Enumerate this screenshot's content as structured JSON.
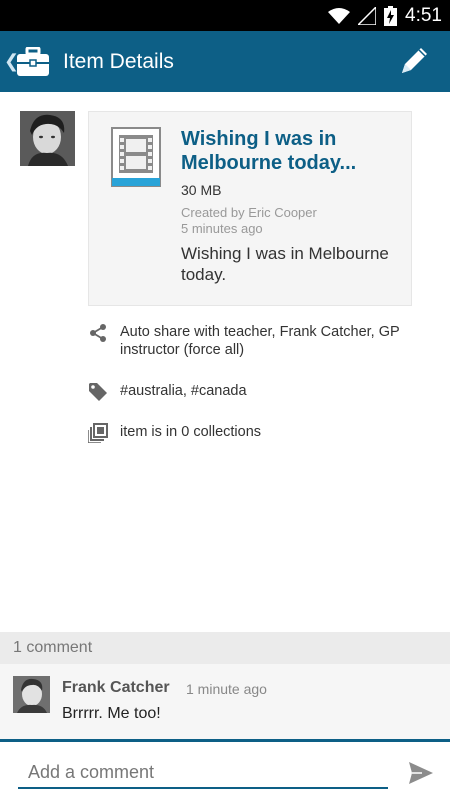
{
  "status_bar": {
    "time": "4:51"
  },
  "app_bar": {
    "title": "Item Details"
  },
  "item": {
    "title": "Wishing I was in Melbourne today...",
    "size": "30 MB",
    "created_by": "Created by Eric Cooper",
    "created_ago": "5 minutes ago",
    "description": "Wishing I was in Melbourne today."
  },
  "info": {
    "share": "Auto share with teacher, Frank Catcher, GP instructor (force all)",
    "tags": "#australia, #canada",
    "collections": "item is in 0 collections"
  },
  "comments": {
    "count_label": "1 comment",
    "items": [
      {
        "author": "Frank Catcher",
        "time": "1 minute ago",
        "text": "Brrrrr. Me too!"
      }
    ]
  },
  "compose": {
    "placeholder": "Add a comment"
  },
  "colors": {
    "primary": "#0d5f86",
    "video_accent": "#29a3d8"
  }
}
